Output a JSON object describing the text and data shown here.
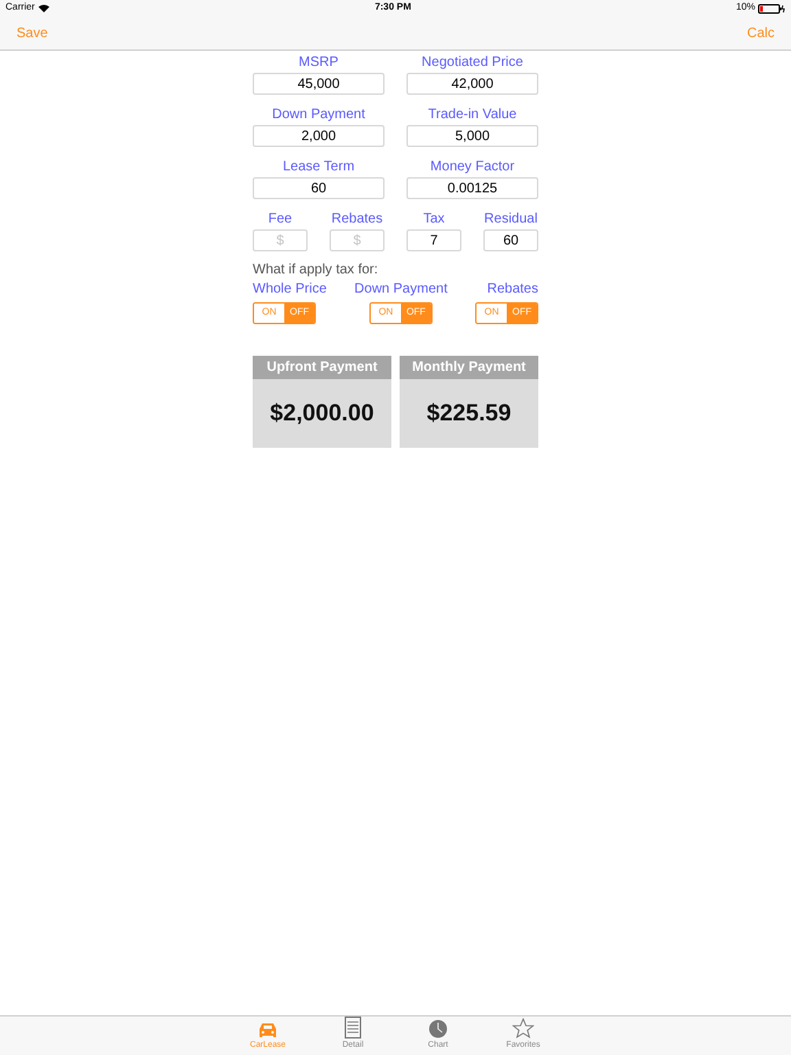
{
  "status_bar": {
    "carrier": "Carrier",
    "time": "7:30 PM",
    "battery": "10%"
  },
  "nav_bar": {
    "left": "Save",
    "right": "Calc"
  },
  "fields": [
    {
      "label": "MSRP",
      "value": "45,000"
    },
    {
      "label": "Negotiated Price",
      "value": "42,000"
    },
    {
      "label": "Down Payment",
      "value": "2,000"
    },
    {
      "label": "Trade-in Value",
      "value": "5,000"
    },
    {
      "label": "Lease Term",
      "value": "60"
    },
    {
      "label": "Money Factor",
      "value": "0.00125"
    }
  ],
  "small_fields": [
    {
      "label": "Fee",
      "placeholder": "$"
    },
    {
      "label": "Rebates",
      "placeholder": "$"
    },
    {
      "label": "Tax",
      "value": "7"
    },
    {
      "label": "Residual",
      "value": "60"
    }
  ],
  "tax_prompt": "What if apply tax for:",
  "toggles": [
    {
      "label": "Whole Price",
      "options": [
        {
          "label": "ON",
          "selected": false
        },
        {
          "label": "OFF",
          "selected": true
        }
      ]
    },
    {
      "label": "Down Payment",
      "options": [
        {
          "label": "ON",
          "selected": false
        },
        {
          "label": "OFF",
          "selected": true
        }
      ]
    },
    {
      "label": "Rebates",
      "options": [
        {
          "label": "ON",
          "selected": false
        },
        {
          "label": "OFF",
          "selected": true
        }
      ]
    }
  ],
  "results": [
    {
      "title": "Upfront Payment",
      "value": "$2,000.00"
    },
    {
      "title": "Monthly Payment",
      "value": "$225.59"
    }
  ],
  "tab_bar": [
    {
      "label": "CarLease",
      "kind": "car",
      "selected": true
    },
    {
      "label": "Detail",
      "kind": "detail",
      "selected": false
    },
    {
      "label": "Chart",
      "kind": "chart",
      "selected": false
    },
    {
      "label": "Favorites",
      "kind": "star",
      "selected": false
    }
  ]
}
